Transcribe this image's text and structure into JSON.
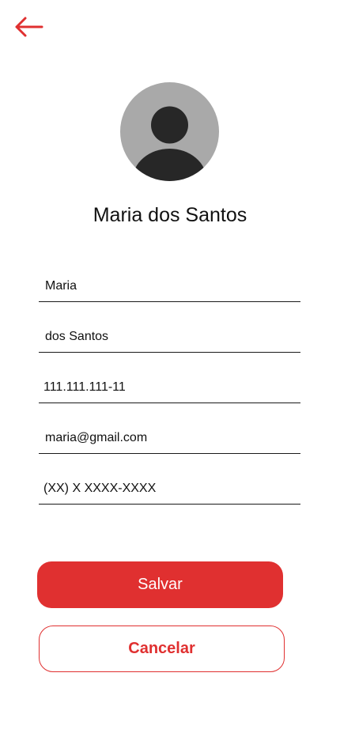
{
  "header": {
    "back_icon": "arrow-left-icon"
  },
  "profile": {
    "avatar_icon": "user-avatar-icon",
    "name": "Maria dos Santos"
  },
  "form": {
    "first_name": {
      "value": "Maria"
    },
    "last_name": {
      "value": "dos Santos"
    },
    "cpf": {
      "value": "111.111.111-11"
    },
    "email": {
      "value": "maria@gmail.com"
    },
    "phone": {
      "value": "(XX) X XXXX-XXXX"
    }
  },
  "actions": {
    "save_label": "Salvar",
    "cancel_label": "Cancelar"
  },
  "colors": {
    "accent": "#e03030",
    "avatar_bg": "#a9a9a9",
    "avatar_fg": "#272727",
    "text": "#111111"
  }
}
